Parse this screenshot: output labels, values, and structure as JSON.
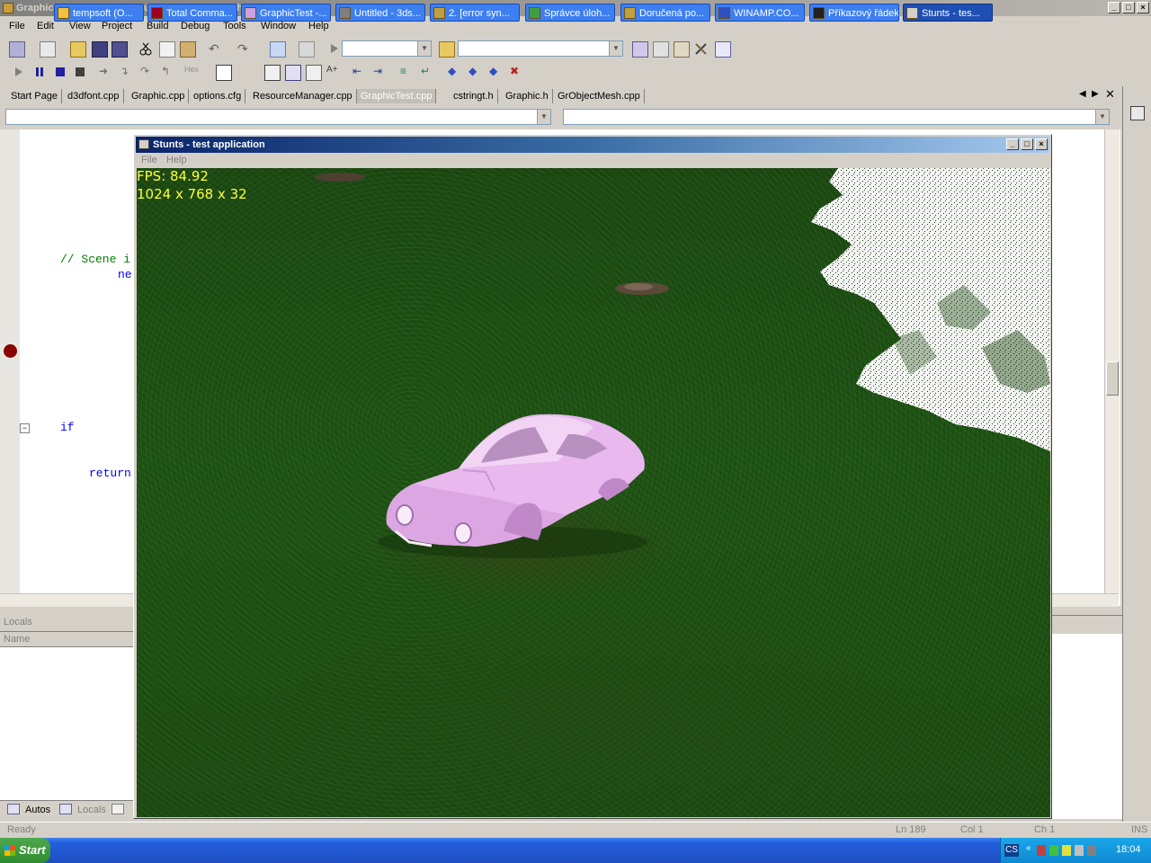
{
  "vs": {
    "title": "GraphicTest - Microsoft Visual C++ [run] - GraphicTest.cpp",
    "menu": [
      "File",
      "Edit",
      "View",
      "Project",
      "Build",
      "Debug",
      "Tools",
      "Window",
      "Help"
    ],
    "tabs": [
      "Start Page",
      "d3dfont.cpp",
      "Graphic.cpp",
      "options.cfg",
      "ResourceManager.cpp",
      "GraphicTest.cpp",
      "cstringt.h",
      "Graphic.h",
      "GrObjectMesh.cpp"
    ],
    "active_tab": "GraphicTest.cpp",
    "code": {
      "line1": "// Scene i",
      "line2": "ne",
      "line3": "if",
      "line4": "return"
    },
    "locals": {
      "title": "Locals",
      "column_name": "Name",
      "tab_autos": "Autos",
      "tab_locals": "Locals"
    },
    "status": {
      "ready": "Ready",
      "ln": "Ln 189",
      "col": "Col 1",
      "ch": "Ch 1",
      "ins": "INS"
    }
  },
  "game": {
    "title": "Stunts - test application",
    "menu": [
      "File",
      "Help"
    ],
    "fps": "FPS: 84.92",
    "resolution": "1024 x 768 x 32"
  },
  "taskbar": {
    "start": "Start",
    "tasks": [
      "tempsoft (O...",
      "Total Comma...",
      "GraphicTest -...",
      "Untitled - 3ds...",
      "2. [error syn...",
      "Správce úloh...",
      "Doručená po...",
      "WINAMP.CO...",
      "Příkazový řádek",
      "Stunts - tes..."
    ],
    "lang": "CS",
    "clock": "18:04"
  },
  "colors": {
    "vs_bg": "#d4d0c8",
    "game_title": "#0a246a",
    "hud_text": "#ffff33",
    "grass": "#1f5514",
    "car": "#e8b8ee",
    "taskbar": "#245edb"
  }
}
